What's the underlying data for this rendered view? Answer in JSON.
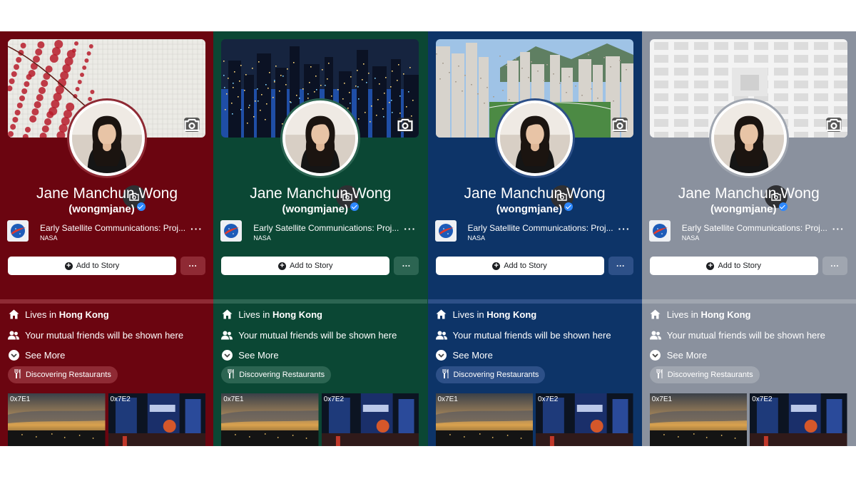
{
  "panels": [
    {
      "id": "red",
      "bg": "#6b0510",
      "accent": "#8f2a34",
      "cover": "wall-red-leaves"
    },
    {
      "id": "green",
      "bg": "#0b4734",
      "accent": "#2c6552",
      "cover": "city-night"
    },
    {
      "id": "blue",
      "bg": "#0d3468",
      "accent": "#2d5088",
      "cover": "city-day"
    },
    {
      "id": "grey",
      "bg": "#8a919e",
      "accent": "#a0a6b0",
      "cover": "white-structure"
    }
  ],
  "profile": {
    "name": "Jane Manchun Wong",
    "handle": "(wongmjane)"
  },
  "music": {
    "title": "Early Satellite Communications: Proj...",
    "artist": "NASA",
    "more": "···"
  },
  "actions": {
    "add_to_story": "Add to Story",
    "more": "···"
  },
  "info": {
    "lives_prefix": "Lives in ",
    "lives_city": "Hong Kong",
    "mutual_friends": "Your mutual friends will be shown here",
    "see_more": "See More",
    "hobby": "Discovering Restaurants"
  },
  "photos": [
    "0x7E1",
    "0x7E2"
  ],
  "icons": [
    "camera-icon",
    "verified-badge-icon",
    "home-icon",
    "friends-icon",
    "chevron-down-icon",
    "utensils-icon",
    "nasa-logo"
  ]
}
